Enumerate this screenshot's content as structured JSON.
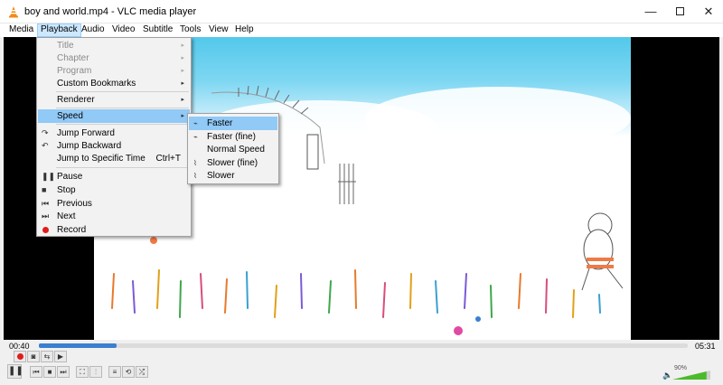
{
  "window": {
    "title": "boy and world.mp4 - VLC media player",
    "minimize_glyph": "—",
    "close_glyph": "✕"
  },
  "menubar": {
    "items": [
      "Media",
      "Playback",
      "Audio",
      "Video",
      "Subtitle",
      "Tools",
      "View",
      "Help"
    ],
    "active": "Playback"
  },
  "playback_menu": {
    "title": "Title",
    "chapter": "Chapter",
    "program": "Program",
    "custom_bookmarks": "Custom Bookmarks",
    "renderer": "Renderer",
    "speed": "Speed",
    "jump_forward": "Jump Forward",
    "jump_backward": "Jump Backward",
    "jump_to_specific_time": "Jump to Specific Time",
    "jump_to_specific_time_shortcut": "Ctrl+T",
    "pause": "Pause",
    "stop": "Stop",
    "previous": "Previous",
    "next": "Next",
    "record": "Record"
  },
  "speed_menu": {
    "faster": "Faster",
    "faster_fine": "Faster (fine)",
    "normal_speed": "Normal Speed",
    "slower_fine": "Slower (fine)",
    "slower": "Slower"
  },
  "player": {
    "current_time": "00:40",
    "total_time": "05:31",
    "progress": 0.12,
    "volume_label": "90%",
    "volume": 0.9
  },
  "icons": {
    "app": "vlc-cone-icon",
    "submenu_arrow": "▸"
  },
  "colors": {
    "accent": "#3a7fd0",
    "menu_highlight": "#91c9f7",
    "record_red": "#e21b1b",
    "sky": "#53c8eb",
    "volume_green": "#4cbb2b"
  }
}
